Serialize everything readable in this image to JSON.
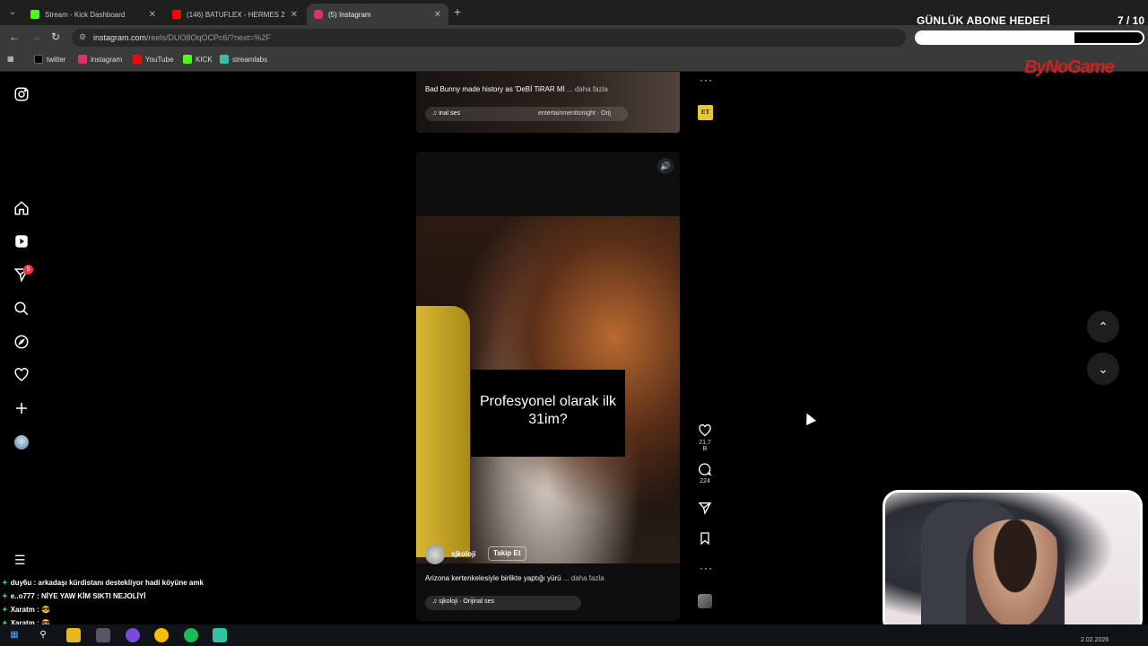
{
  "browser": {
    "tabs": [
      {
        "title": "Stream - Kick Dashboard",
        "favicon_color": "#53fc18"
      },
      {
        "title": "(146) BATUFLEX - HERMES 2.0",
        "favicon_color": "#ff0000"
      },
      {
        "title": "(5) Instagram",
        "favicon_color": "#e1306c"
      }
    ],
    "url": "instagram.com",
    "url_path": "/reels/DUO8OqOCPc6/?next=%2F",
    "bookmarks": [
      {
        "label": "twitter",
        "color": "#000000"
      },
      {
        "label": "instagram",
        "color": "#e1306c"
      },
      {
        "label": "YouTube",
        "color": "#ff0000"
      },
      {
        "label": "KICK",
        "color": "#53fc18"
      },
      {
        "label": "streamlabs",
        "color": "#31c3a2"
      }
    ]
  },
  "overlay": {
    "goal_title": "GÜNLÜK ABONE HEDEFİ",
    "goal_count": "7  / 10",
    "goal_progress": 0.7,
    "brand": "ByNoGame"
  },
  "sidebar": {
    "notification_count": "5"
  },
  "reel_top": {
    "caption": "Bad Bunny made history as 'DeBİ TiRAR Mİ",
    "caption_more": "... daha fazla",
    "audio": "inal ses",
    "audio_credit": "entertainmenttonight · Orij",
    "badge": "ET"
  },
  "reel_main": {
    "subtitle": "Profesyonel olarak ilk 31im?",
    "author": "sjkoloji",
    "follow": "Takip Et",
    "caption": "Arizona kertenkelesiyle birlikte yaptığı yürü",
    "caption_more": "... daha fazla",
    "audio": "sjkoloji · Orijinal ses",
    "likes": "21,7 B",
    "comments": "224"
  },
  "chat": [
    {
      "user": "duy6u",
      "message": ": arkadaşı kürdistanı destekliyor hadi köyüne amk"
    },
    {
      "user": "e..o777",
      "message": ": NİYE YAW KİM SIKTI NEJOLİYİ"
    },
    {
      "user": "Xaratm",
      "message": ": 😎"
    },
    {
      "user": "Xaratm",
      "message": ": 😎"
    }
  ],
  "taskbar": {
    "date": "2.02.2026"
  }
}
